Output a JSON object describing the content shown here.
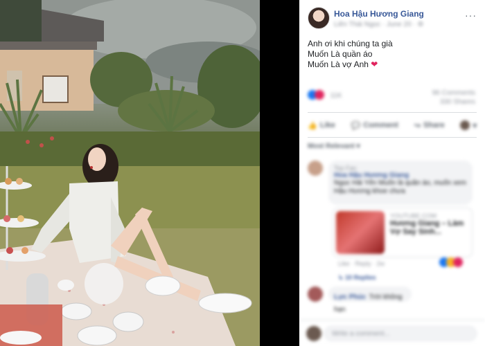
{
  "post": {
    "author": "Hoa Hậu Hương Giang",
    "meta": "Liên Thái Ngọc · June 20 · ⚙",
    "caption_lines": [
      "Anh ơi khi chúng ta già",
      "Muốn Là quần áo",
      "Muốn Là vợ Anh"
    ],
    "heart": "❤"
  },
  "reactions": {
    "count": "11K",
    "comments": "96 Comments",
    "shares": "330 Shares"
  },
  "actions": {
    "like": "Like",
    "comment": "Comment",
    "share": "Share"
  },
  "sort_label": "Most Relevant ▾",
  "comments": [
    {
      "badge": "Top Fan",
      "name": "Hoa Hậu Hương Giang",
      "text": "Ngọc Hải Yến Muốn là quần áo, muốn xem Hậu Hương khoe chưa",
      "link_source": "YOUTUBE.COM",
      "link_title": "Hương Giang – Làm Vợ Say Sinh...",
      "link_meta": "Like · Reply · 2w",
      "replies": "↳ 10 Replies"
    },
    {
      "name": "Lực Phúc",
      "text": "Trời không hạn"
    }
  ],
  "composer": {
    "placeholder": "Write a comment..."
  },
  "colors": {
    "link": "#385898",
    "heart": "#e0245e",
    "like_blue": "#1877f2"
  }
}
